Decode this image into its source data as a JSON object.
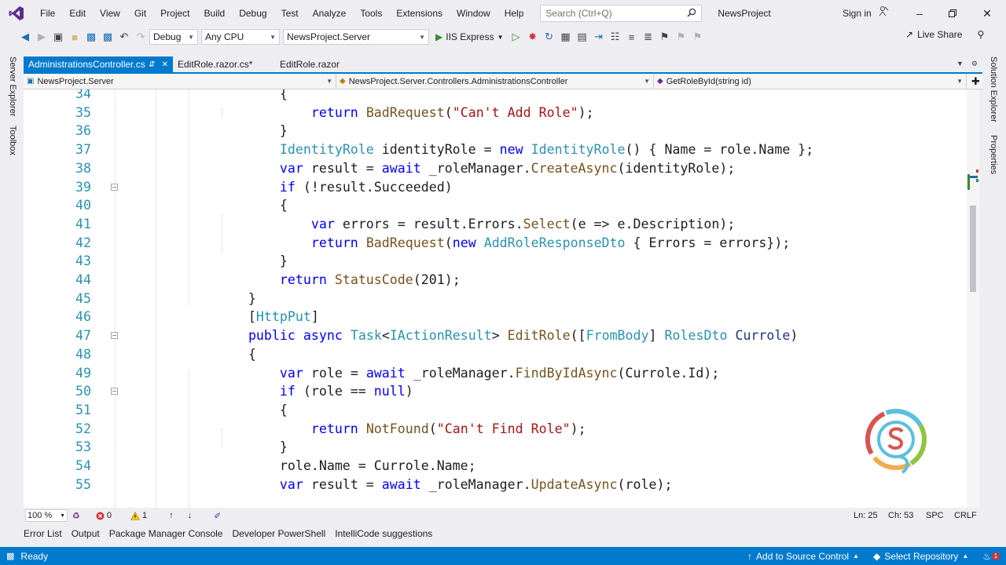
{
  "menu": {
    "items": [
      "File",
      "Edit",
      "View",
      "Git",
      "Project",
      "Build",
      "Debug",
      "Test",
      "Analyze",
      "Tools",
      "Extensions",
      "Window",
      "Help"
    ],
    "search_placeholder": "Search (Ctrl+Q)",
    "solution_name": "NewsProject",
    "signin_label": "Sign in"
  },
  "toolbar": {
    "config": "Debug",
    "platform": "Any CPU",
    "startup_project": "NewsProject.Server",
    "run_target": "IIS Express",
    "live_share": "Live Share"
  },
  "side_tabs": {
    "left": [
      "Server Explorer",
      "Toolbox"
    ],
    "right": [
      "Solution Explorer",
      "Properties"
    ]
  },
  "doc_tabs": [
    {
      "label": "AdministrationsController.cs",
      "active": true
    },
    {
      "label": "EditRole.razor.cs*",
      "active": false
    },
    {
      "label": "EditRole.razor",
      "active": false
    }
  ],
  "navbar": {
    "project": "NewsProject.Server",
    "class": "NewsProject.Server.Controllers.AdministrationsController",
    "member": "GetRoleById(string id)"
  },
  "code_lines": [
    {
      "n": "34",
      "tokens": [
        {
          "t": "            {",
          "c": ""
        }
      ]
    },
    {
      "n": "35",
      "tokens": [
        {
          "t": "                ",
          "c": ""
        },
        {
          "t": "return",
          "c": "kw"
        },
        {
          "t": " ",
          "c": ""
        },
        {
          "t": "BadRequest",
          "c": "me"
        },
        {
          "t": "(",
          "c": ""
        },
        {
          "t": "\"Can't Add Role\"",
          "c": "st"
        },
        {
          "t": ");",
          "c": ""
        }
      ]
    },
    {
      "n": "36",
      "tokens": [
        {
          "t": "            }",
          "c": ""
        }
      ]
    },
    {
      "n": "37",
      "tokens": [
        {
          "t": "            ",
          "c": ""
        },
        {
          "t": "IdentityRole",
          "c": "ty"
        },
        {
          "t": " identityRole = ",
          "c": ""
        },
        {
          "t": "new",
          "c": "kw"
        },
        {
          "t": " ",
          "c": ""
        },
        {
          "t": "IdentityRole",
          "c": "ty"
        },
        {
          "t": "() { Name = role.Name };",
          "c": ""
        }
      ]
    },
    {
      "n": "38",
      "tokens": [
        {
          "t": "            ",
          "c": ""
        },
        {
          "t": "var",
          "c": "kw"
        },
        {
          "t": " result = ",
          "c": ""
        },
        {
          "t": "await",
          "c": "kw"
        },
        {
          "t": " _roleManager.",
          "c": ""
        },
        {
          "t": "CreateAsync",
          "c": "me"
        },
        {
          "t": "(identityRole);",
          "c": ""
        }
      ]
    },
    {
      "n": "39",
      "fold": true,
      "tokens": [
        {
          "t": "            ",
          "c": ""
        },
        {
          "t": "if",
          "c": "kw"
        },
        {
          "t": " (!result.Succeeded)",
          "c": ""
        }
      ]
    },
    {
      "n": "40",
      "tokens": [
        {
          "t": "            {",
          "c": ""
        }
      ]
    },
    {
      "n": "41",
      "tokens": [
        {
          "t": "                ",
          "c": ""
        },
        {
          "t": "var",
          "c": "kw"
        },
        {
          "t": " errors = result.Errors.",
          "c": ""
        },
        {
          "t": "Select",
          "c": "me"
        },
        {
          "t": "(e => e.Description);",
          "c": ""
        }
      ]
    },
    {
      "n": "42",
      "tokens": [
        {
          "t": "                ",
          "c": ""
        },
        {
          "t": "return",
          "c": "kw"
        },
        {
          "t": " ",
          "c": ""
        },
        {
          "t": "BadRequest",
          "c": "me"
        },
        {
          "t": "(",
          "c": ""
        },
        {
          "t": "new",
          "c": "kw"
        },
        {
          "t": " ",
          "c": ""
        },
        {
          "t": "AddRoleResponseDto",
          "c": "ty"
        },
        {
          "t": " { Errors = errors});",
          "c": ""
        }
      ]
    },
    {
      "n": "43",
      "tokens": [
        {
          "t": "            }",
          "c": ""
        }
      ]
    },
    {
      "n": "44",
      "tokens": [
        {
          "t": "            ",
          "c": ""
        },
        {
          "t": "return",
          "c": "kw"
        },
        {
          "t": " ",
          "c": ""
        },
        {
          "t": "StatusCode",
          "c": "me"
        },
        {
          "t": "(201);",
          "c": ""
        }
      ]
    },
    {
      "n": "45",
      "tokens": [
        {
          "t": "        }",
          "c": ""
        }
      ]
    },
    {
      "n": "46",
      "tokens": [
        {
          "t": "        [",
          "c": ""
        },
        {
          "t": "HttpPut",
          "c": "ty"
        },
        {
          "t": "]",
          "c": ""
        }
      ]
    },
    {
      "n": "47",
      "fold": true,
      "tokens": [
        {
          "t": "        ",
          "c": ""
        },
        {
          "t": "public",
          "c": "kw"
        },
        {
          "t": " ",
          "c": ""
        },
        {
          "t": "async",
          "c": "kw"
        },
        {
          "t": " ",
          "c": ""
        },
        {
          "t": "Task",
          "c": "ty"
        },
        {
          "t": "<",
          "c": ""
        },
        {
          "t": "IActionResult",
          "c": "ty"
        },
        {
          "t": "> ",
          "c": ""
        },
        {
          "t": "EditRole",
          "c": "me"
        },
        {
          "t": "([",
          "c": ""
        },
        {
          "t": "FromBody",
          "c": "ty"
        },
        {
          "t": "] ",
          "c": ""
        },
        {
          "t": "RolesDto",
          "c": "ty"
        },
        {
          "t": " ",
          "c": ""
        },
        {
          "t": "Currole",
          "c": "pa"
        },
        {
          "t": ")",
          "c": ""
        }
      ]
    },
    {
      "n": "48",
      "tokens": [
        {
          "t": "        {",
          "c": ""
        }
      ]
    },
    {
      "n": "49",
      "tokens": [
        {
          "t": "            ",
          "c": ""
        },
        {
          "t": "var",
          "c": "kw"
        },
        {
          "t": " role = ",
          "c": ""
        },
        {
          "t": "await",
          "c": "kw"
        },
        {
          "t": " _roleManager.",
          "c": ""
        },
        {
          "t": "FindByIdAsync",
          "c": "me"
        },
        {
          "t": "(Currole.Id);",
          "c": ""
        }
      ]
    },
    {
      "n": "50",
      "fold": true,
      "tokens": [
        {
          "t": "            ",
          "c": ""
        },
        {
          "t": "if",
          "c": "kw"
        },
        {
          "t": " (role == ",
          "c": ""
        },
        {
          "t": "null",
          "c": "kw"
        },
        {
          "t": ")",
          "c": ""
        }
      ]
    },
    {
      "n": "51",
      "tokens": [
        {
          "t": "            {",
          "c": ""
        }
      ]
    },
    {
      "n": "52",
      "tokens": [
        {
          "t": "                ",
          "c": ""
        },
        {
          "t": "return",
          "c": "kw"
        },
        {
          "t": " ",
          "c": ""
        },
        {
          "t": "NotFound",
          "c": "me"
        },
        {
          "t": "(",
          "c": ""
        },
        {
          "t": "\"Can't Find Role\"",
          "c": "st"
        },
        {
          "t": ");",
          "c": ""
        }
      ]
    },
    {
      "n": "53",
      "tokens": [
        {
          "t": "            }",
          "c": ""
        }
      ]
    },
    {
      "n": "54",
      "tokens": [
        {
          "t": "            role.Name = Currole.Name;",
          "c": ""
        }
      ]
    },
    {
      "n": "55",
      "tokens": [
        {
          "t": "            ",
          "c": ""
        },
        {
          "t": "var",
          "c": "kw"
        },
        {
          "t": " result = ",
          "c": ""
        },
        {
          "t": "await",
          "c": "kw"
        },
        {
          "t": " _roleManager.",
          "c": ""
        },
        {
          "t": "UpdateAsync",
          "c": "me"
        },
        {
          "t": "(role);",
          "c": ""
        }
      ]
    }
  ],
  "editor_status": {
    "zoom": "100 %",
    "errors": "0",
    "warnings": "1",
    "line": "Ln: 25",
    "col": "Ch: 53",
    "spacing": "SPC",
    "line_ending": "CRLF"
  },
  "tool_tabs": [
    "Error List",
    "Output",
    "Package Manager Console",
    "Developer PowerShell",
    "IntelliCode suggestions"
  ],
  "status_bar": {
    "ready": "Ready",
    "add_source_control": "Add to Source Control",
    "select_repository": "Select Repository",
    "notification_count": "1"
  },
  "colors": {
    "accent": "#007acc",
    "keyword": "#0000ff",
    "type": "#2b91af",
    "string": "#a31515",
    "method": "#74531f"
  }
}
